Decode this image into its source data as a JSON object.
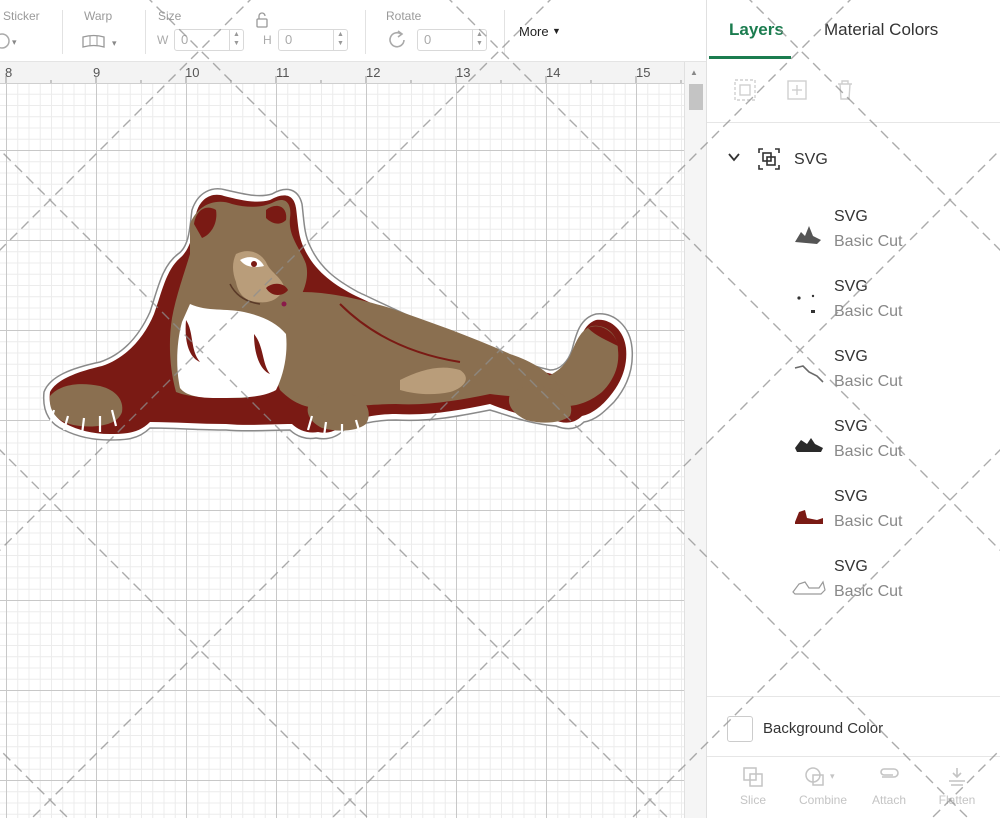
{
  "toolbar": {
    "sticker_label": "Sticker",
    "warp_label": "Warp",
    "size_label": "Size",
    "width_prefix": "W",
    "width_value": "0",
    "height_prefix": "H",
    "height_value": "0",
    "rotate_label": "Rotate",
    "rotate_value": "0",
    "more_label": "More"
  },
  "ruler": {
    "ticks": [
      "8",
      "9",
      "10",
      "11",
      "12",
      "13",
      "14",
      "15"
    ]
  },
  "panel": {
    "tabs": [
      {
        "label": "Layers",
        "active": true
      },
      {
        "label": "Material Colors",
        "active": false
      }
    ],
    "actions": [
      "group-icon",
      "add-icon",
      "delete-icon"
    ],
    "group": {
      "label": "SVG"
    },
    "layers": [
      {
        "name": "SVG",
        "type": "Basic Cut",
        "thumb_color": "#555555"
      },
      {
        "name": "SVG",
        "type": "Basic Cut",
        "thumb_color": "#333333"
      },
      {
        "name": "SVG",
        "type": "Basic Cut",
        "thumb_color": "#6a6a6a"
      },
      {
        "name": "SVG",
        "type": "Basic Cut",
        "thumb_color": "#2a2a2a"
      },
      {
        "name": "SVG",
        "type": "Basic Cut",
        "thumb_color": "#7a1a14"
      },
      {
        "name": "SVG",
        "type": "Basic Cut",
        "thumb_color": "#9a9a9a"
      }
    ],
    "background_color_label": "Background Color",
    "bottom_actions": {
      "slice": "Slice",
      "combine": "Combine",
      "attach": "Attach",
      "flatten": "Flatten"
    }
  },
  "colors": {
    "accent": "#1b7c4f",
    "cat_tan": "#8a6f50",
    "cat_light": "#b99d7a",
    "cat_maroon": "#7a1a14",
    "cat_white": "#ffffff"
  }
}
